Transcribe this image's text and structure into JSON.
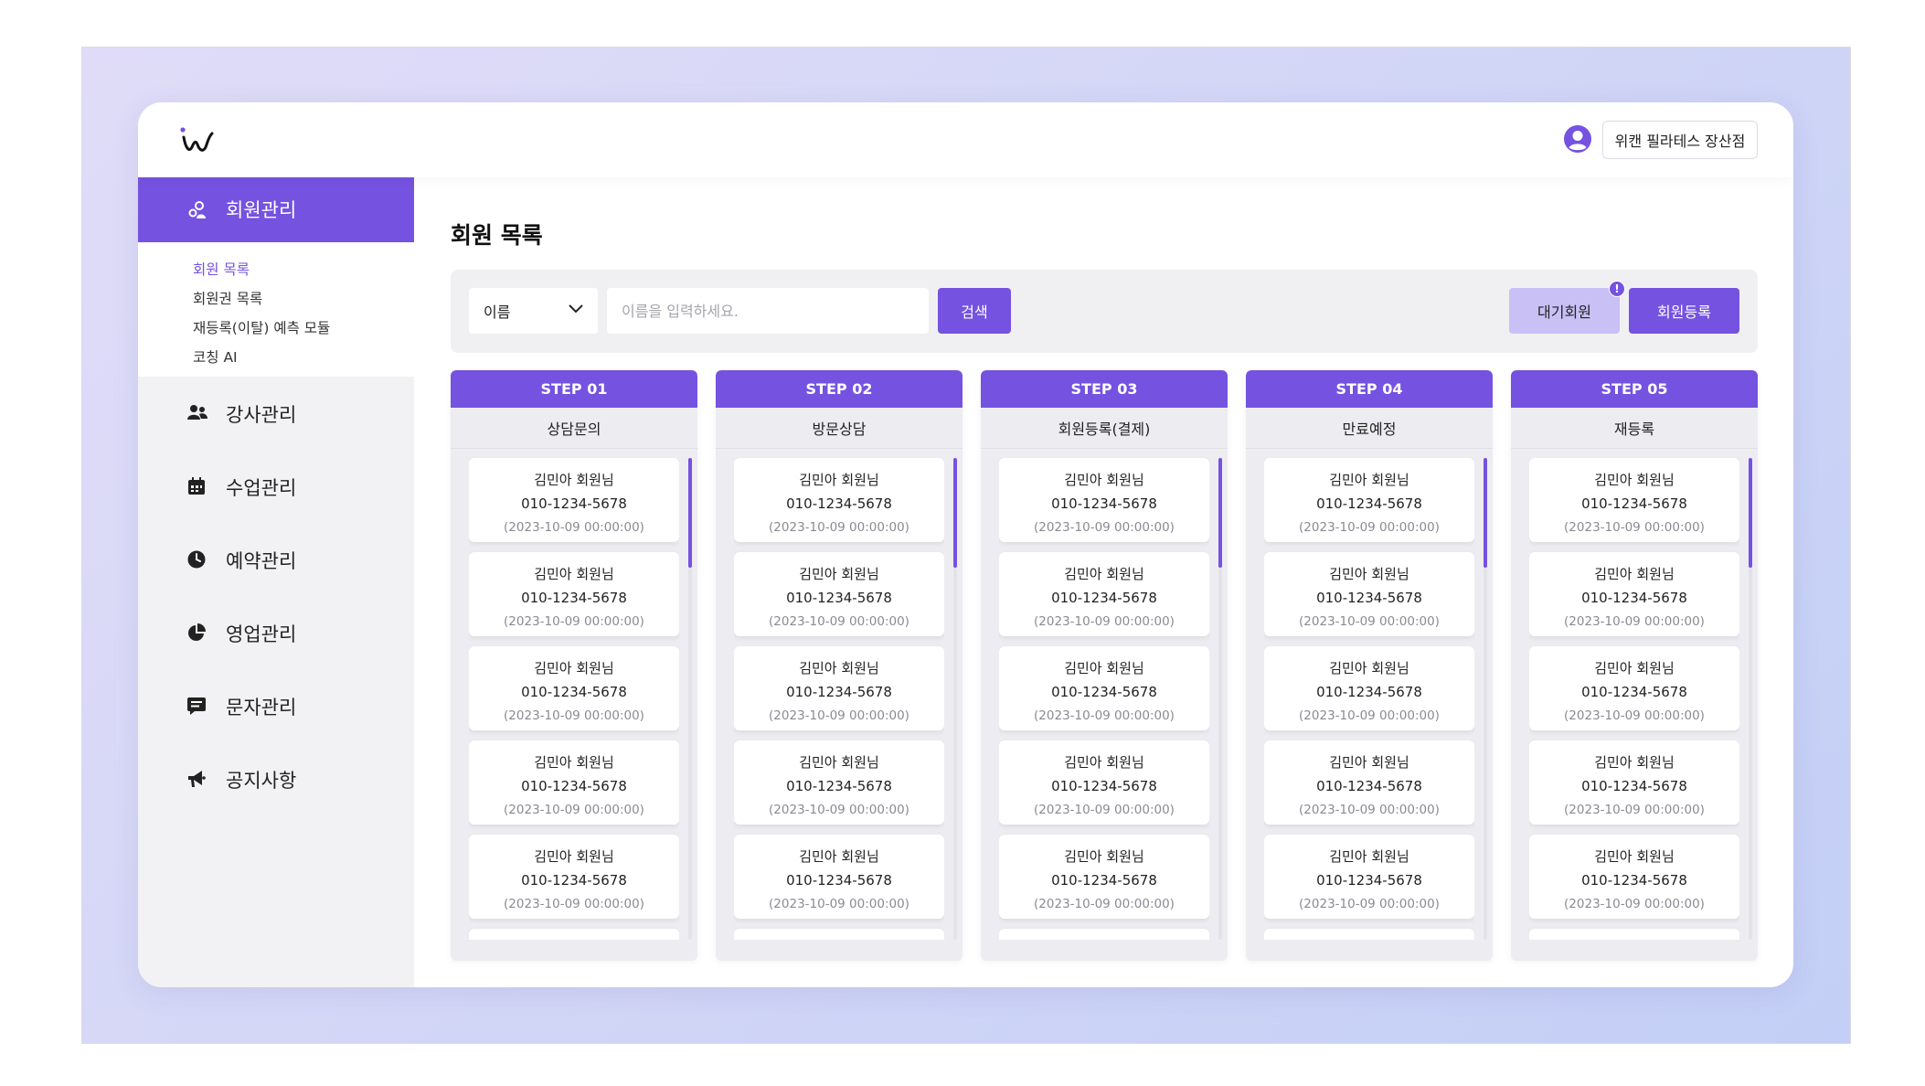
{
  "header": {
    "branch_label": "위캔 필라테스 장산점",
    "logo_icon": "wecan-logo-icon",
    "user_icon": "user-circle-icon"
  },
  "sidebar": {
    "active": {
      "label": "회원관리",
      "icon": "members-icon"
    },
    "submenu": [
      "회원 목록",
      "회원권 목록",
      "재등록(이탈) 예측 모듈",
      "코칭 AI"
    ],
    "items": [
      {
        "label": "강사관리",
        "icon": "users-icon"
      },
      {
        "label": "수업관리",
        "icon": "calendar-icon"
      },
      {
        "label": "예약관리",
        "icon": "clock-icon"
      },
      {
        "label": "영업관리",
        "icon": "pie-chart-icon"
      },
      {
        "label": "문자관리",
        "icon": "message-icon"
      },
      {
        "label": "공지사항",
        "icon": "megaphone-icon"
      }
    ]
  },
  "main": {
    "title": "회원 목록",
    "search": {
      "select_value": "이름",
      "placeholder": "이름을 입력하세요.",
      "search_button": "검색",
      "waiting_button": "대기회원",
      "waiting_badge": "!",
      "register_button": "회원등록"
    }
  },
  "kanban": [
    {
      "step": "STEP 01",
      "title": "상담문의",
      "cards": [
        {
          "name": "김민아 회원님",
          "phone": "010-1234-5678",
          "date": "(2023-10-09 00:00:00)"
        },
        {
          "name": "김민아 회원님",
          "phone": "010-1234-5678",
          "date": "(2023-10-09 00:00:00)"
        },
        {
          "name": "김민아 회원님",
          "phone": "010-1234-5678",
          "date": "(2023-10-09 00:00:00)"
        },
        {
          "name": "김민아 회원님",
          "phone": "010-1234-5678",
          "date": "(2023-10-09 00:00:00)"
        },
        {
          "name": "김민아 회원님",
          "phone": "010-1234-5678",
          "date": "(2023-10-09 00:00:00)"
        }
      ]
    },
    {
      "step": "STEP 02",
      "title": "방문상담",
      "cards": [
        {
          "name": "김민아 회원님",
          "phone": "010-1234-5678",
          "date": "(2023-10-09 00:00:00)"
        },
        {
          "name": "김민아 회원님",
          "phone": "010-1234-5678",
          "date": "(2023-10-09 00:00:00)"
        },
        {
          "name": "김민아 회원님",
          "phone": "010-1234-5678",
          "date": "(2023-10-09 00:00:00)"
        },
        {
          "name": "김민아 회원님",
          "phone": "010-1234-5678",
          "date": "(2023-10-09 00:00:00)"
        },
        {
          "name": "김민아 회원님",
          "phone": "010-1234-5678",
          "date": "(2023-10-09 00:00:00)"
        }
      ]
    },
    {
      "step": "STEP 03",
      "title": "회원등록(결제)",
      "cards": [
        {
          "name": "김민아 회원님",
          "phone": "010-1234-5678",
          "date": "(2023-10-09 00:00:00)"
        },
        {
          "name": "김민아 회원님",
          "phone": "010-1234-5678",
          "date": "(2023-10-09 00:00:00)"
        },
        {
          "name": "김민아 회원님",
          "phone": "010-1234-5678",
          "date": "(2023-10-09 00:00:00)"
        },
        {
          "name": "김민아 회원님",
          "phone": "010-1234-5678",
          "date": "(2023-10-09 00:00:00)"
        },
        {
          "name": "김민아 회원님",
          "phone": "010-1234-5678",
          "date": "(2023-10-09 00:00:00)"
        }
      ]
    },
    {
      "step": "STEP 04",
      "title": "만료예정",
      "cards": [
        {
          "name": "김민아 회원님",
          "phone": "010-1234-5678",
          "date": "(2023-10-09 00:00:00)"
        },
        {
          "name": "김민아 회원님",
          "phone": "010-1234-5678",
          "date": "(2023-10-09 00:00:00)"
        },
        {
          "name": "김민아 회원님",
          "phone": "010-1234-5678",
          "date": "(2023-10-09 00:00:00)"
        },
        {
          "name": "김민아 회원님",
          "phone": "010-1234-5678",
          "date": "(2023-10-09 00:00:00)"
        },
        {
          "name": "김민아 회원님",
          "phone": "010-1234-5678",
          "date": "(2023-10-09 00:00:00)"
        }
      ]
    },
    {
      "step": "STEP 05",
      "title": "재등록",
      "cards": [
        {
          "name": "김민아 회원님",
          "phone": "010-1234-5678",
          "date": "(2023-10-09 00:00:00)"
        },
        {
          "name": "김민아 회원님",
          "phone": "010-1234-5678",
          "date": "(2023-10-09 00:00:00)"
        },
        {
          "name": "김민아 회원님",
          "phone": "010-1234-5678",
          "date": "(2023-10-09 00:00:00)"
        },
        {
          "name": "김민아 회원님",
          "phone": "010-1234-5678",
          "date": "(2023-10-09 00:00:00)"
        },
        {
          "name": "김민아 회원님",
          "phone": "010-1234-5678",
          "date": "(2023-10-09 00:00:00)"
        }
      ]
    }
  ],
  "colors": {
    "accent": "#7552e0",
    "accent_light": "#c9c0f6",
    "sidebar_bg": "#f2f2f4"
  }
}
